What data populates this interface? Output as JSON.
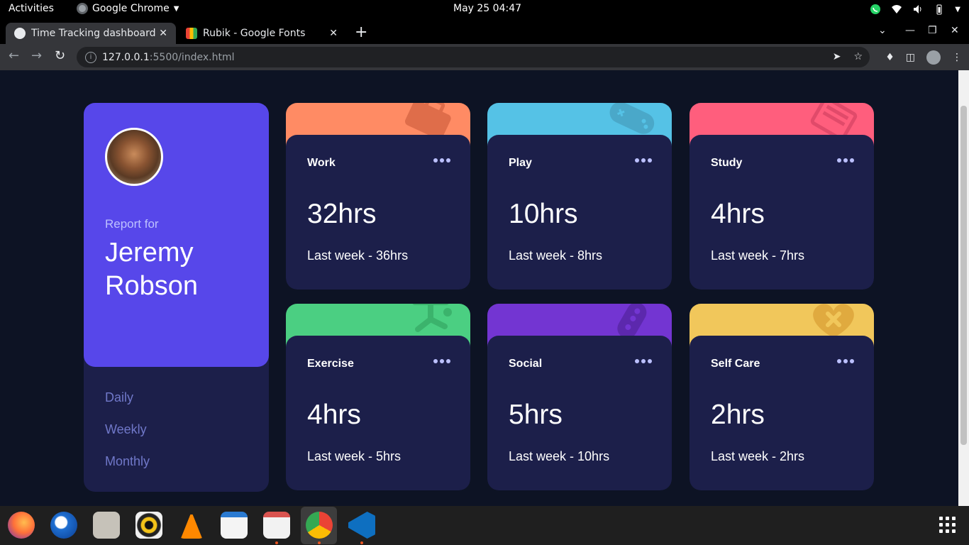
{
  "system": {
    "activities": "Activities",
    "app_name": "Google Chrome",
    "clock": "May 25  04:47"
  },
  "browser": {
    "tabs": [
      {
        "label": "Time Tracking dashboard",
        "active": true
      },
      {
        "label": "Rubik - Google Fonts",
        "active": false
      }
    ],
    "url_host": "127.0.0.1",
    "url_path": ":5500/index.html"
  },
  "dashboard": {
    "report_for": "Report for",
    "user_name": "Jeremy Robson",
    "periods": [
      "Daily",
      "Weekly",
      "Monthly"
    ],
    "cards": [
      {
        "title": "Work",
        "hours": "32hrs",
        "previous": "Last week - 36hrs",
        "color": "#ff8b64",
        "icon": "briefcase-icon"
      },
      {
        "title": "Play",
        "hours": "10hrs",
        "previous": "Last week - 8hrs",
        "color": "#55c2e6",
        "icon": "gamepad-icon"
      },
      {
        "title": "Study",
        "hours": "4hrs",
        "previous": "Last week - 7hrs",
        "color": "#ff5e7d",
        "icon": "book-icon"
      },
      {
        "title": "Exercise",
        "hours": "4hrs",
        "previous": "Last week - 5hrs",
        "color": "#4bcf82",
        "icon": "runner-icon"
      },
      {
        "title": "Social",
        "hours": "5hrs",
        "previous": "Last week - 10hrs",
        "color": "#7335d2",
        "icon": "social-icon"
      },
      {
        "title": "Self Care",
        "hours": "2hrs",
        "previous": "Last week - 2hrs",
        "color": "#f1c75b",
        "icon": "heart-icon"
      }
    ]
  },
  "dock": {
    "apps": [
      "firefox-icon",
      "thunderbird-icon",
      "files-icon",
      "rhythmbox-icon",
      "vlc-icon",
      "writer-icon",
      "document-viewer-icon",
      "chrome-icon",
      "vscode-icon"
    ]
  }
}
